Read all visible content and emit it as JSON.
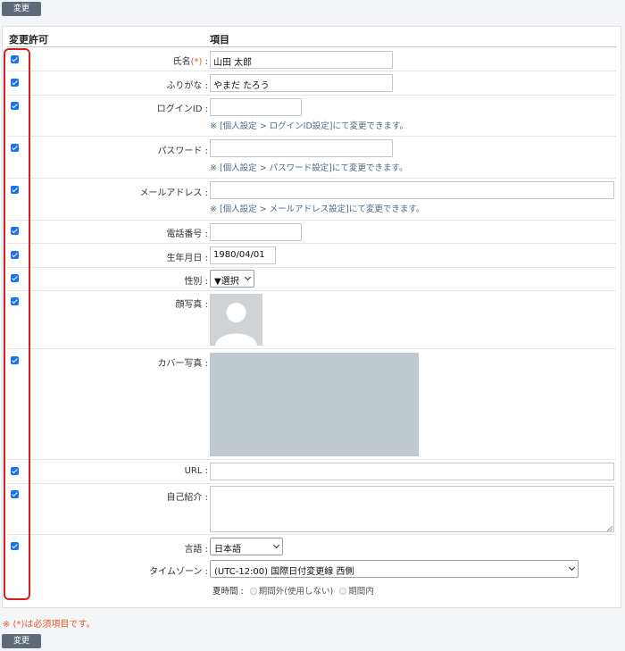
{
  "buttons": {
    "change_label": "変更"
  },
  "headers": {
    "permission": "変更許可",
    "item": "項目"
  },
  "colors": {
    "accent": "#1a73e8",
    "button_bg": "#5f6b78",
    "required": "#e05a2b",
    "highlight_box": "#d62020"
  },
  "fields": {
    "name": {
      "label": "氏名",
      "required_mark": "(*)",
      "colon": " :",
      "value": "山田 太郎",
      "permitted": true
    },
    "furigana": {
      "label": "ふりがな :",
      "value": "やまだ たろう",
      "permitted": true
    },
    "login_id": {
      "label": "ログインID :",
      "value": "",
      "note": "※ [個人設定 > ログインID設定]にて変更できます。",
      "permitted": true
    },
    "password": {
      "label": "パスワード :",
      "value": "",
      "note": "※ [個人設定 > パスワード設定]にて変更できます。",
      "permitted": true
    },
    "email": {
      "label": "メールアドレス :",
      "value": "",
      "note": "※ [個人設定 > メールアドレス設定]にて変更できます。",
      "permitted": true
    },
    "phone": {
      "label": "電話番号 :",
      "value": "",
      "permitted": true
    },
    "birthday": {
      "label": "生年月日 :",
      "value": "1980/04/01",
      "permitted": true
    },
    "gender": {
      "label": "性別 :",
      "selected": "▼選択",
      "permitted": true
    },
    "photo": {
      "label": "顔写真 :",
      "icon": "default-avatar-icon",
      "permitted": true
    },
    "cover": {
      "label": "カバー写真 :",
      "placeholder_color": "#bfc9ce",
      "permitted": true
    },
    "url": {
      "label": "URL :",
      "value": "",
      "permitted": true
    },
    "intro": {
      "label": "自己紹介 :",
      "value": "",
      "permitted": true
    },
    "language": {
      "label": "言語 :",
      "selected": "日本語",
      "permitted": true
    },
    "timezone": {
      "label": "タイムゾーン :",
      "selected": "(UTC-12:00) 国際日付変更線 西側"
    },
    "dst": {
      "label": "夏時間 :",
      "option_outside": "期間外(使用しない)",
      "option_inside": "期間内"
    }
  },
  "footer": {
    "required_note": "※ (*)は必須項目です。"
  }
}
